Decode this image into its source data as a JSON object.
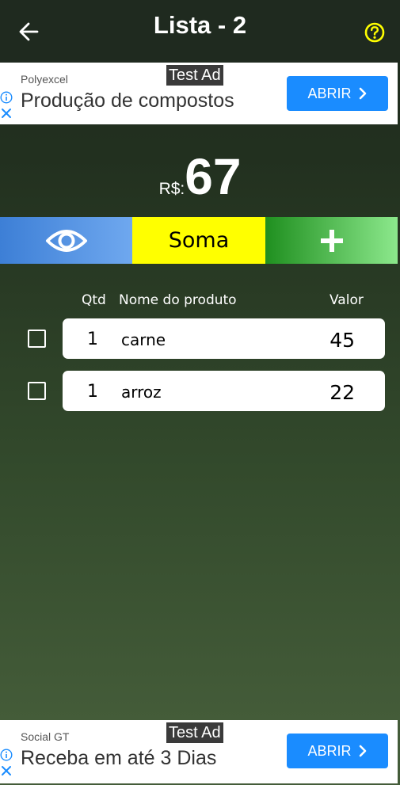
{
  "header": {
    "title": "Lista - 2",
    "back_icon": "arrow-left-icon",
    "help_icon": "help-circle-icon",
    "help_color": "#ffff00"
  },
  "ads": [
    {
      "brand": "Polyexcel",
      "test_label": "Test Ad",
      "headline": "Produção de compostos",
      "button_label": "ABRIR"
    },
    {
      "brand": "Social GT",
      "test_label": "Test Ad",
      "headline": "Receba em até 3 Dias",
      "button_label": "ABRIR"
    }
  ],
  "total": {
    "currency": "R$:",
    "amount": "67"
  },
  "actions": {
    "view_icon": "eye-icon",
    "sum_label": "Soma",
    "add_icon": "plus-icon"
  },
  "columns": {
    "qty": "Qtd",
    "name": "Nome do produto",
    "value": "Valor"
  },
  "items": [
    {
      "qty": "1",
      "name": "carne",
      "value": "45",
      "checked": false
    },
    {
      "qty": "1",
      "name": "arroz",
      "value": "22",
      "checked": false
    }
  ],
  "colors": {
    "ad_button": "#1a8cff",
    "sum_bg": "#ffff00",
    "view_bg": "#3d7fd6",
    "add_bg": "#1f8f1f"
  }
}
